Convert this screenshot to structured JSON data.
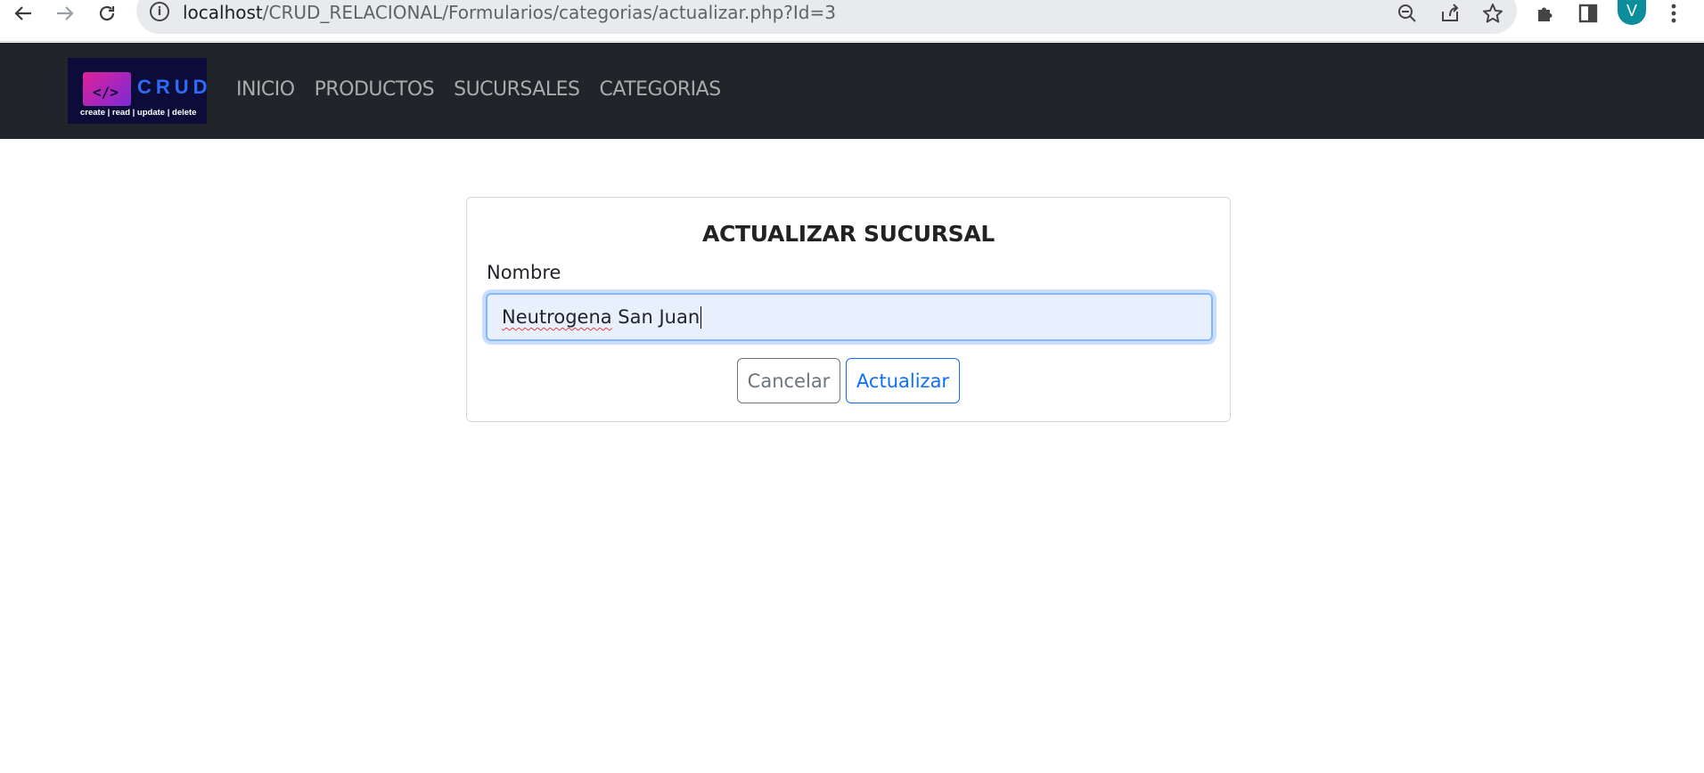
{
  "browser": {
    "url_host": "localhost",
    "url_path": "/CRUD_RELACIONAL/Formularios/categorias/actualizar.php?Id=3",
    "profile_initial": "V"
  },
  "navbar": {
    "logo_title": "CRUD",
    "logo_code": "</>",
    "logo_subtitle": "create | read | update | delete",
    "links": [
      "INICIO",
      "PRODUCTOS",
      "SUCURSALES",
      "CATEGORIAS"
    ]
  },
  "form": {
    "title": "ACTUALIZAR SUCURSAL",
    "field_label": "Nombre",
    "field_value_word1": "Neutrogena",
    "field_value_rest": " San Juan",
    "cancel_label": "Cancelar",
    "submit_label": "Actualizar"
  },
  "colors": {
    "navbar_bg": "#212529",
    "primary": "#0d6efd",
    "secondary": "#6c757d",
    "avatar": "#0b8d9c"
  }
}
